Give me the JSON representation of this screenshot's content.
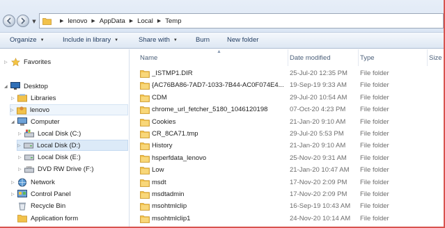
{
  "address_bar": {
    "crumbs": [
      "lenovo",
      "AppData",
      "Local",
      "Temp"
    ]
  },
  "toolbar": {
    "organize": "Organize",
    "include_in_library": "Include in library",
    "share_with": "Share with",
    "burn": "Burn",
    "new_folder": "New folder"
  },
  "nav": {
    "favorites": "Favorites",
    "desktop": "Desktop",
    "libraries": "Libraries",
    "lenovo": "lenovo",
    "computer": "Computer",
    "local_c": "Local Disk (C:)",
    "local_d": "Local Disk (D:)",
    "local_e": "Local Disk (E:)",
    "dvd": "DVD RW Drive (F:)",
    "network": "Network",
    "control_panel": "Control Panel",
    "recycle_bin": "Recycle Bin",
    "application_form": "Application form"
  },
  "columns": {
    "name": "Name",
    "date_modified": "Date modified",
    "type": "Type",
    "size": "Size"
  },
  "files": [
    {
      "name": "_ISTMP1.DIR",
      "date": "25-Jul-20 12:35 PM",
      "type": "File folder"
    },
    {
      "name": "{AC76BA86-7AD7-1033-7B44-AC0F074E4...",
      "date": "19-Sep-19 9:33 AM",
      "type": "File folder"
    },
    {
      "name": "CDM",
      "date": "29-Jul-20 10:54 AM",
      "type": "File folder"
    },
    {
      "name": "chrome_url_fetcher_5180_1046120198",
      "date": "07-Oct-20 4:23 PM",
      "type": "File folder"
    },
    {
      "name": "Cookies",
      "date": "21-Jan-20 9:10 AM",
      "type": "File folder"
    },
    {
      "name": "CR_8CA71.tmp",
      "date": "29-Jul-20 5:53 PM",
      "type": "File folder"
    },
    {
      "name": "History",
      "date": "21-Jan-20 9:10 AM",
      "type": "File folder"
    },
    {
      "name": "hsperfdata_lenovo",
      "date": "25-Nov-20 9:31 AM",
      "type": "File folder"
    },
    {
      "name": "Low",
      "date": "21-Jan-20 10:47 AM",
      "type": "File folder"
    },
    {
      "name": "msdt",
      "date": "17-Nov-20 2:09 PM",
      "type": "File folder"
    },
    {
      "name": "msdtadmin",
      "date": "17-Nov-20 2:09 PM",
      "type": "File folder"
    },
    {
      "name": "msohtmlclip",
      "date": "16-Sep-19 10:43 AM",
      "type": "File folder"
    },
    {
      "name": "msohtmlclip1",
      "date": "24-Nov-20 10:14 AM",
      "type": "File folder"
    }
  ],
  "colors": {
    "folder": "#f2c24b",
    "selection": "#dceaf8",
    "toolbar_text": "#1f3a5f",
    "frame_border": "#d9534f"
  }
}
